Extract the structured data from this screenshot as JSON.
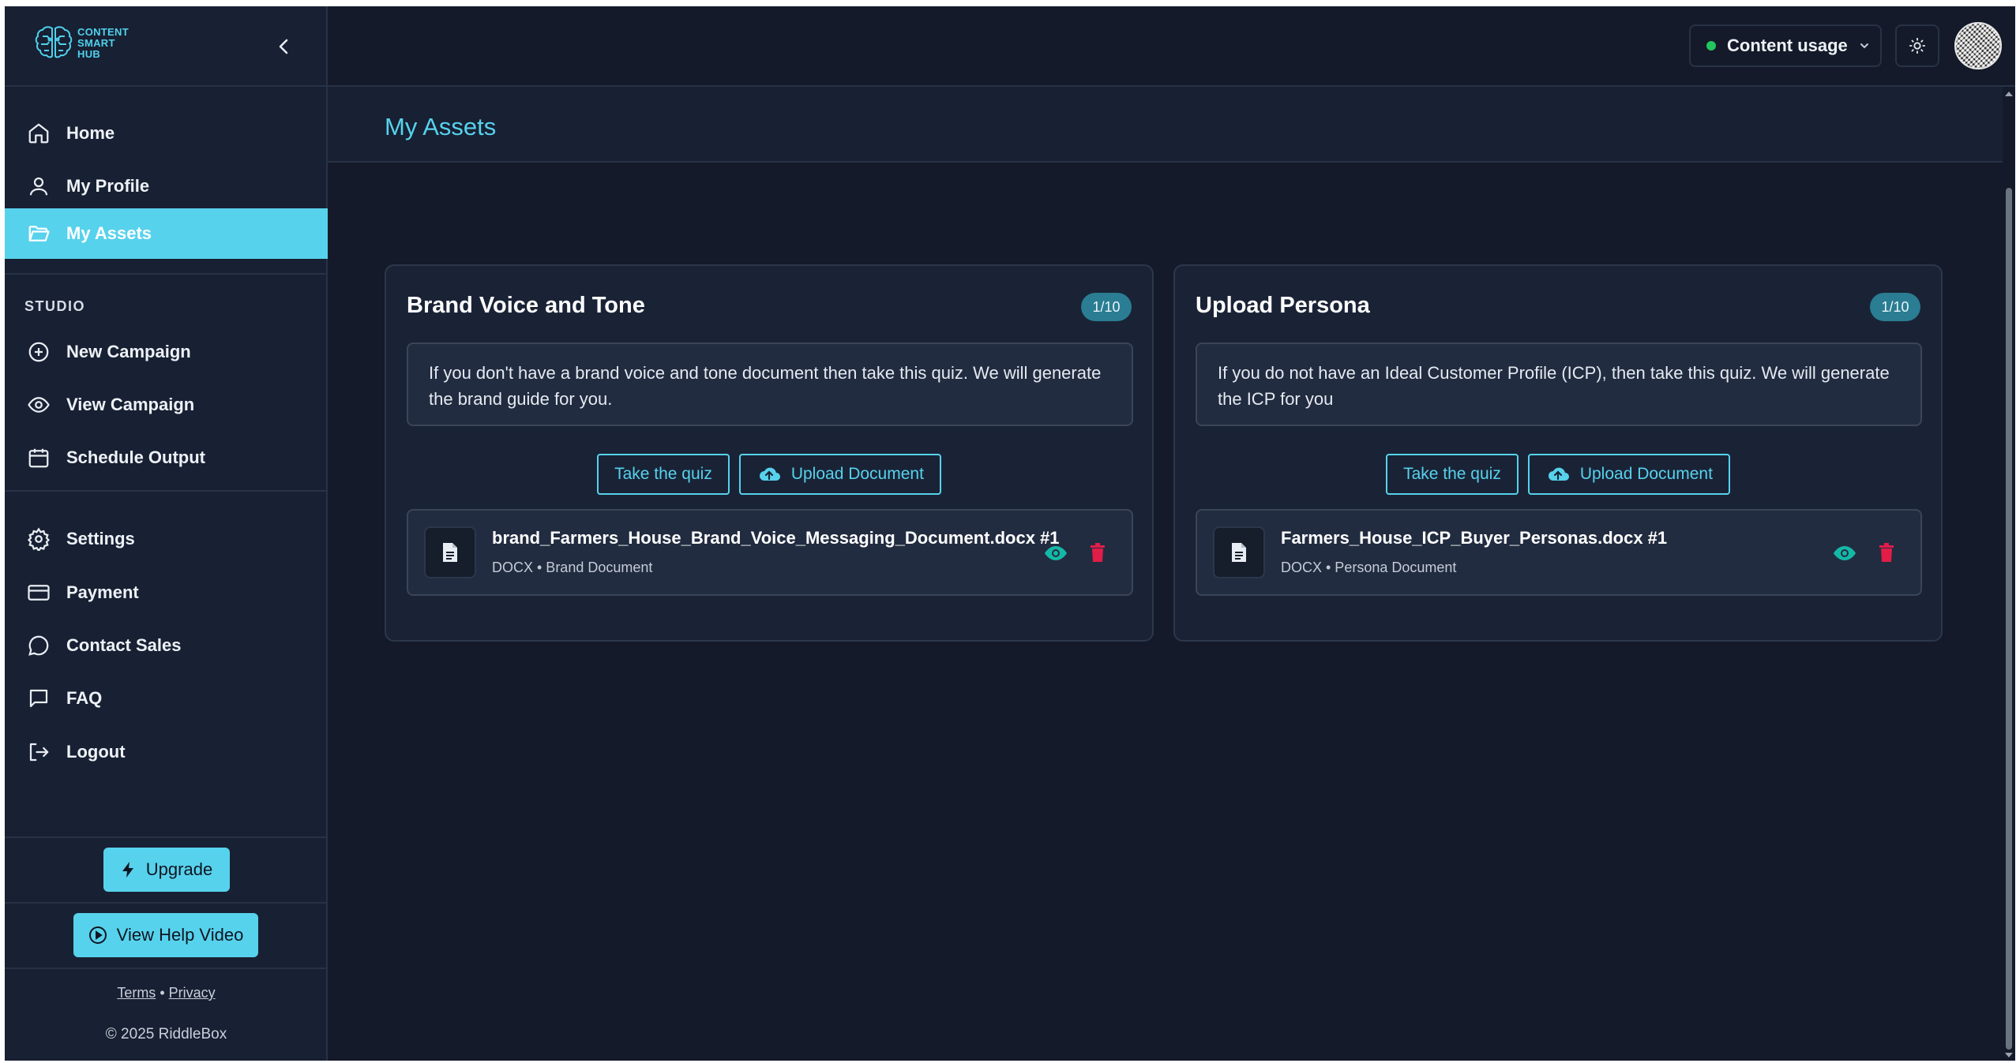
{
  "app": {
    "logo_text": [
      "CONTENT",
      "SMART",
      "HUB"
    ]
  },
  "sidebar": {
    "items_top": [
      {
        "label": "Home",
        "icon": "home-icon"
      },
      {
        "label": "My Profile",
        "icon": "user-icon"
      },
      {
        "label": "My Assets",
        "icon": "folder-open-icon",
        "active": true
      }
    ],
    "section_label": "STUDIO",
    "items_studio": [
      {
        "label": "New Campaign",
        "icon": "plus-circle-icon"
      },
      {
        "label": "View Campaign",
        "icon": "eye-icon"
      },
      {
        "label": "Schedule Output",
        "icon": "calendar-icon"
      }
    ],
    "items_bottom": [
      {
        "label": "Settings",
        "icon": "gear-icon"
      },
      {
        "label": "Payment",
        "icon": "credit-card-icon"
      },
      {
        "label": "Contact Sales",
        "icon": "chat-bubble-icon"
      },
      {
        "label": "FAQ",
        "icon": "message-square-icon"
      },
      {
        "label": "Logout",
        "icon": "logout-icon"
      }
    ],
    "upgrade_label": "Upgrade",
    "help_video_label": "View Help Video",
    "terms_label": "Terms",
    "legal_separator": "•",
    "privacy_label": "Privacy",
    "copyright": "© 2025 RiddleBox"
  },
  "topbar": {
    "usage_label": "Content usage",
    "usage_status_color": "#22c55e"
  },
  "page": {
    "title": "My Assets"
  },
  "cards": [
    {
      "title": "Brand Voice and Tone",
      "badge": "1/10",
      "info": "If you don't have a brand voice and tone document then take this quiz. We will generate the brand guide for you.",
      "quiz_label": "Take the quiz",
      "upload_label": "Upload Document",
      "file": {
        "name": "brand_Farmers_House_Brand_Voice_Messaging_Document.docx #1",
        "meta": "DOCX • Brand Document"
      }
    },
    {
      "title": "Upload Persona",
      "badge": "1/10",
      "info": "If you do not have an Ideal Customer Profile (ICP), then take this quiz. We will generate the ICP for you",
      "quiz_label": "Take the quiz",
      "upload_label": "Upload Document",
      "file": {
        "name": "Farmers_House_ICP_Buyer_Personas.docx #1",
        "meta": "DOCX • Persona Document"
      }
    }
  ],
  "colors": {
    "accent": "#57d2ec",
    "background": "#141a29",
    "sidebar": "#182033",
    "view_icon": "#14b8a6",
    "delete_icon": "#e11d48"
  }
}
